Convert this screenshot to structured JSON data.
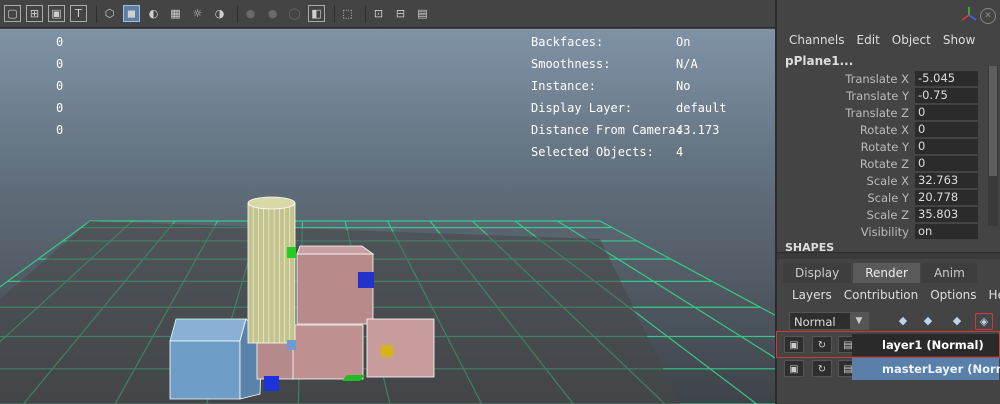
{
  "toolbar": {
    "icons": [
      {
        "name": "camera-attributes-icon",
        "glyph": "▢",
        "boxed": true
      },
      {
        "name": "grid-toggle-icon",
        "glyph": "⊞",
        "boxed": true
      },
      {
        "name": "image-plane-icon",
        "glyph": "▣",
        "boxed": true
      },
      {
        "name": "text-overlay-icon",
        "glyph": "T",
        "boxed": true
      },
      {
        "name": "wireframe-cube-icon",
        "glyph": "⬡"
      },
      {
        "name": "smooth-shade-cube-icon",
        "glyph": "◼",
        "active": true
      },
      {
        "name": "shaded-wireframe-icon",
        "glyph": "◐"
      },
      {
        "name": "textured-icon",
        "glyph": "▦"
      },
      {
        "name": "use-all-lights-icon",
        "glyph": "☼"
      },
      {
        "name": "shadows-icon",
        "glyph": "◑"
      },
      {
        "name": "screen-space-ao-icon",
        "glyph": "●",
        "dim": true
      },
      {
        "name": "motion-blur-icon",
        "glyph": "●",
        "dim": true
      },
      {
        "name": "antialiasing-icon",
        "glyph": "◯",
        "dim": true
      },
      {
        "name": "depth-of-field-icon",
        "glyph": "◧",
        "boxed": true
      },
      {
        "name": "isolate-select-icon",
        "glyph": "⬚"
      },
      {
        "name": "xray-icon",
        "glyph": "⊡"
      },
      {
        "name": "xray-joints-icon",
        "glyph": "⊟"
      },
      {
        "name": "xray-components-icon",
        "glyph": "▤"
      }
    ]
  },
  "hud_left": {
    "values": [
      "0",
      "0",
      "0",
      "0",
      "0"
    ]
  },
  "hud": {
    "rows": [
      {
        "key": "Backfaces:",
        "value": "On"
      },
      {
        "key": "Smoothness:",
        "value": "N/A"
      },
      {
        "key": "Instance:",
        "value": "No"
      },
      {
        "key": "Display Layer:",
        "value": "default"
      },
      {
        "key": "Distance From Camera:",
        "value": "43.173"
      },
      {
        "key": "Selected Objects:",
        "value": "4"
      }
    ]
  },
  "channel_box": {
    "menu": [
      "Channels",
      "Edit",
      "Object",
      "Show"
    ],
    "object_name": "pPlane1...",
    "attributes": [
      {
        "label": "Translate X",
        "value": "-5.045"
      },
      {
        "label": "Translate Y",
        "value": "-0.75"
      },
      {
        "label": "Translate Z",
        "value": "0"
      },
      {
        "label": "Rotate X",
        "value": "0"
      },
      {
        "label": "Rotate Y",
        "value": "0"
      },
      {
        "label": "Rotate Z",
        "value": "0"
      },
      {
        "label": "Scale X",
        "value": "32.763"
      },
      {
        "label": "Scale Y",
        "value": "20.778"
      },
      {
        "label": "Scale Z",
        "value": "35.803"
      },
      {
        "label": "Visibility",
        "value": "on"
      }
    ],
    "shapes_label": "SHAPES"
  },
  "layer_editor": {
    "tabs": [
      "Display",
      "Render",
      "Anim"
    ],
    "active_tab": "Render",
    "menu": [
      "Layers",
      "Contribution",
      "Options",
      "Help"
    ],
    "mode": "Normal",
    "tool_icons": [
      {
        "name": "move-layer-up-icon",
        "glyph": "◆"
      },
      {
        "name": "move-layer-down-icon",
        "glyph": "◆"
      },
      {
        "name": "create-empty-layer-icon",
        "glyph": "◆"
      },
      {
        "name": "create-layer-from-selected-icon",
        "glyph": "◈",
        "highlighted": true
      }
    ],
    "layers": [
      {
        "name": "layer1 (Normal)",
        "selected": false,
        "bg": "#2a2a2a",
        "color": "#ffffff"
      },
      {
        "name": "masterLayer (Normal)",
        "selected": true,
        "bg": "#5a7fa8",
        "color": "#eaf2ff"
      }
    ]
  },
  "colors": {
    "grid_line": "#37d48a",
    "wire_selected": "#ffffff",
    "panel_bg": "#444444",
    "selection_blue": "#5a7fa8",
    "highlight_red": "#d13a3a"
  }
}
